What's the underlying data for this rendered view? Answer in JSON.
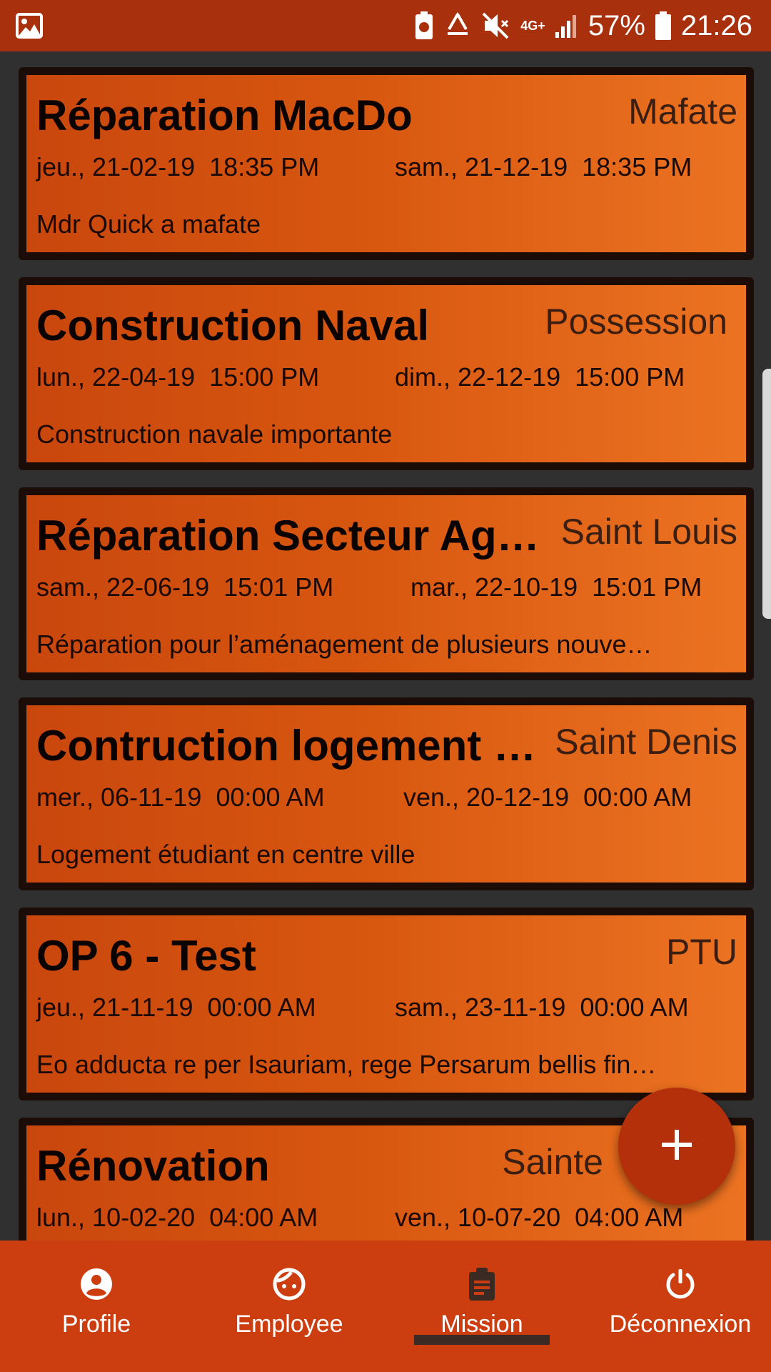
{
  "status_bar": {
    "battery_percent": "57%",
    "time": "21:26",
    "network": "4G+",
    "icons": [
      "image-icon",
      "battery-saver-icon",
      "recycle-icon",
      "mute-icon",
      "signal-icon",
      "battery-icon"
    ]
  },
  "missions": [
    {
      "title": "Réparation MacDo",
      "location": "Mafate",
      "start": "jeu., 21-02-19  18:35 PM",
      "end": "sam., 21-12-19  18:35 PM",
      "description": "Mdr Quick a mafate"
    },
    {
      "title": "Construction Naval",
      "location": "Possession",
      "start": "lun., 22-04-19  15:00 PM",
      "end": "dim., 22-12-19  15:00 PM",
      "description": "Construction navale importante"
    },
    {
      "title": "Réparation Secteur Ag…",
      "location": "Saint Louis",
      "start": "sam., 22-06-19  15:01 PM",
      "end": "mar., 22-10-19  15:01 PM",
      "description": "Réparation pour l’aménagement de plusieurs nouve…"
    },
    {
      "title": "Contruction logement …",
      "location": "Saint Denis",
      "start": "mer., 06-11-19  00:00 AM",
      "end": "ven., 20-12-19  00:00 AM",
      "description": "Logement étudiant en centre ville"
    },
    {
      "title": "OP 6 - Test",
      "location": "PTU",
      "start": "jeu., 21-11-19  00:00 AM",
      "end": "sam., 23-11-19  00:00 AM",
      "description": "Eo adducta re per Isauriam, rege Persarum bellis fin…"
    },
    {
      "title": "Rénovation",
      "location": "Sainte",
      "start": "lun., 10-02-20  04:00 AM",
      "end": "ven., 10-07-20  04:00 AM",
      "description": ""
    }
  ],
  "fab": {
    "icon": "plus-icon"
  },
  "bottom_nav": {
    "active": "Mission",
    "items": [
      {
        "label": "Profile",
        "icon": "account-circle-icon"
      },
      {
        "label": "Employee",
        "icon": "face-icon"
      },
      {
        "label": "Mission",
        "icon": "clipboard-icon"
      },
      {
        "label": "Déconnexion",
        "icon": "power-icon"
      }
    ]
  },
  "colors": {
    "status_bar": "#a8300c",
    "bottom_nav": "#cc3d10",
    "card_gradient_start": "#c9470d",
    "card_gradient_end": "#ec7322",
    "background": "#303030",
    "fab": "#b3300b"
  }
}
